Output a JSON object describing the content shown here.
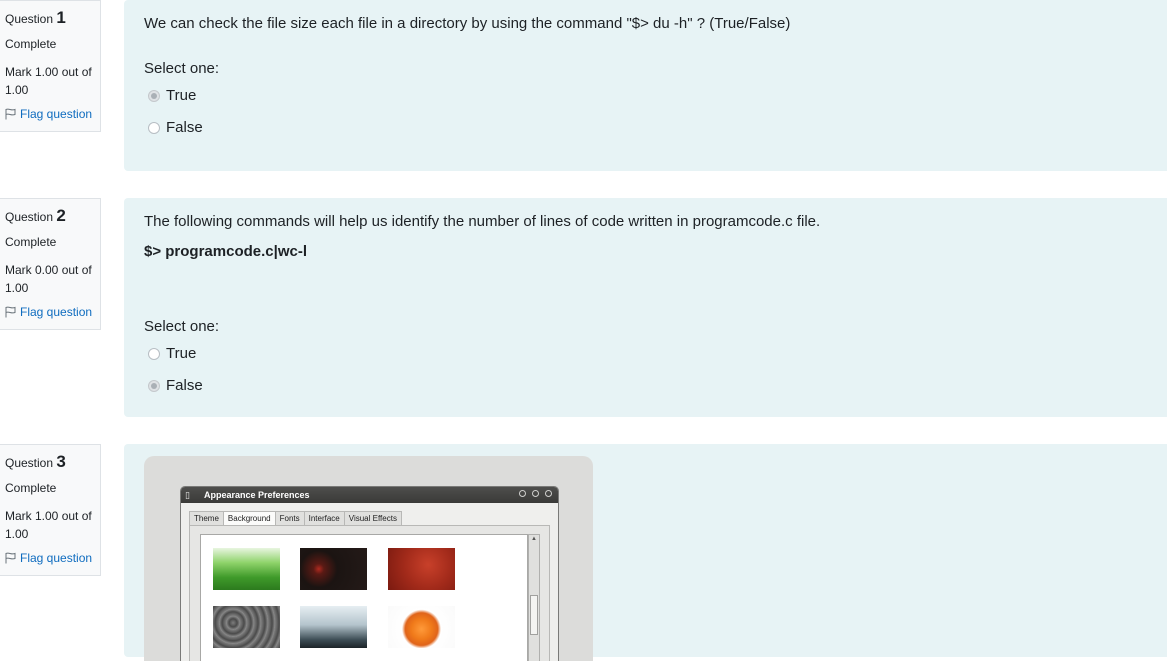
{
  "questions": [
    {
      "label": "Question",
      "number": "1",
      "state": "Complete",
      "grade": "Mark 1.00 out of 1.00",
      "flag": "Flag question",
      "text": "We can check the file size each file in a directory by using the command \"$> du -h\" ? (True/False)",
      "prompt": "Select one:",
      "options": [
        {
          "label": "True",
          "checked": true
        },
        {
          "label": "False",
          "checked": false
        }
      ]
    },
    {
      "label": "Question",
      "number": "2",
      "state": "Complete",
      "grade": "Mark 0.00 out of 1.00",
      "flag": "Flag question",
      "text": "The following commands will help us identify the number of lines of code written in programcode.c file.",
      "code": "$> programcode.c|wc-l",
      "prompt": "Select one:",
      "options": [
        {
          "label": "True",
          "checked": false
        },
        {
          "label": "False",
          "checked": true
        }
      ]
    },
    {
      "label": "Question",
      "number": "3",
      "state": "Complete",
      "grade": "Mark 1.00 out of 1.00",
      "flag": "Flag question",
      "image": {
        "window_title": "Appearance Preferences",
        "tabs": [
          "Theme",
          "Background",
          "Fonts",
          "Interface",
          "Visual Effects"
        ],
        "active_tab": "Background",
        "thumbnails": [
          "green-grass",
          "dark-red-flower",
          "red-texture",
          "grey-texture",
          "blue-fog",
          "orange-flower"
        ]
      }
    }
  ],
  "colors": {
    "content_bg": "#e7f3f5",
    "info_bg": "#f8f9fa",
    "link": "#0f6cbf"
  }
}
